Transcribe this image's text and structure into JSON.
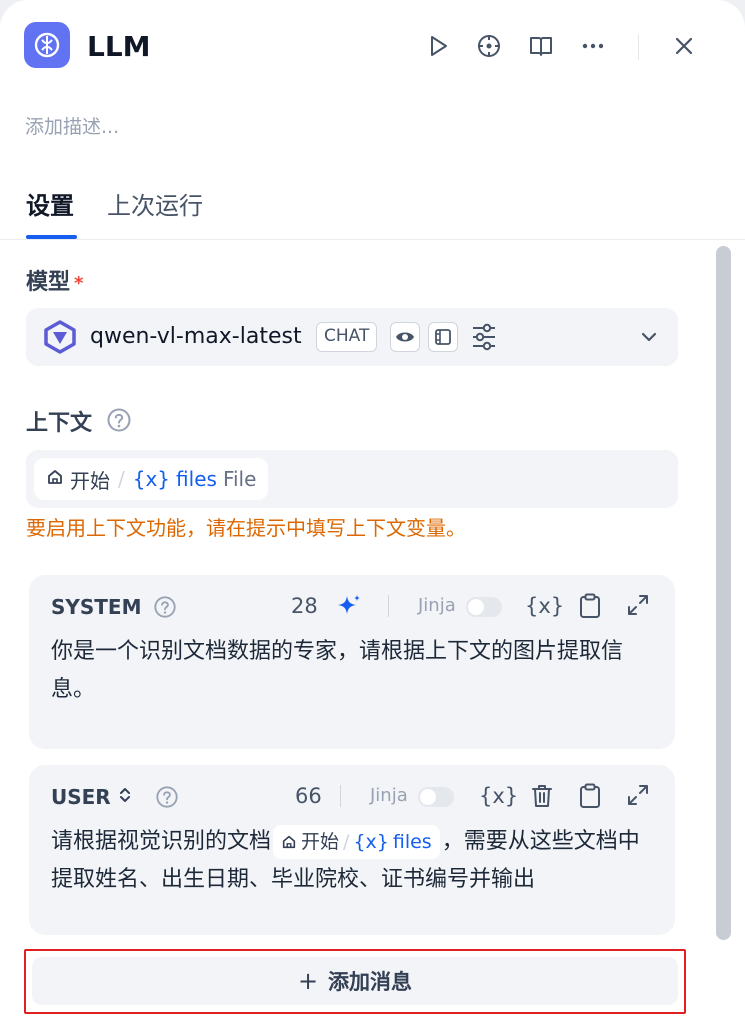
{
  "header": {
    "title": "LLM",
    "icons": [
      "brain-icon",
      "play-icon",
      "crosshair-icon",
      "book-icon",
      "more-icon",
      "close-icon"
    ]
  },
  "description_placeholder": "添加描述...",
  "tabs": [
    {
      "label": "设置",
      "active": true
    },
    {
      "label": "上次运行",
      "active": false
    }
  ],
  "model": {
    "label": "模型",
    "required_mark": "*",
    "name": "qwen-vl-max-latest",
    "mode_badge": "CHAT",
    "icons": [
      "qwen-logo-icon",
      "vision-icon",
      "video-icon",
      "sliders-icon",
      "chevron-down-icon"
    ]
  },
  "context": {
    "label": "上下文",
    "variable": {
      "node": "开始",
      "separator": "/",
      "var_prefix": "{x}",
      "name": "files",
      "type": "File"
    },
    "warning": "要启用上下文功能，请在提示中填写上下文变量。"
  },
  "prompts": [
    {
      "role": "SYSTEM",
      "count": "28",
      "jinja_label": "Jinja",
      "text": "你是一个识别文档数据的专家，请根据上下文的图片提取信息。"
    },
    {
      "role": "USER",
      "role_switch": "⌃",
      "count": "66",
      "jinja_label": "Jinja",
      "text_before": "请根据视觉识别的文档",
      "chip_node": "开始",
      "chip_var_prefix": "{x}",
      "chip_var": "files",
      "text_after": "，需要从这些文档中提取姓名、出生日期、毕业院校、证书编号并输出"
    }
  ],
  "add_message": {
    "plus": "+",
    "label": "添加消息"
  },
  "colors": {
    "accent": "#155eef",
    "warning": "#dc6803",
    "required": "#f04438",
    "highlight_box": "#e02020"
  }
}
